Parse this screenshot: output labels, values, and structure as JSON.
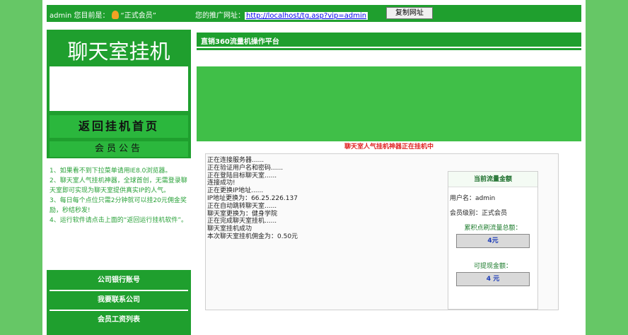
{
  "topbar": {
    "user": "admin",
    "level_prefix": "您目前是：",
    "level": "“正式会员”",
    "promo_label": "您的推广网址：",
    "promo_url": "http://localhost/tg.asp?vip=admin",
    "copy_button": "复制网址"
  },
  "sidebar": {
    "logo_title": "聊天室挂机",
    "home_link": "返回挂机首页",
    "notice_title": "会员公告",
    "notices": [
      "1、如果看不到下拉菜单请用IE8.0浏览器。",
      "2、聊天室人气挂机神器，全球首创，无需登录聊天室即可实现为聊天室提供真实IP的人气。",
      "3、每日每个点位只需2分钟就可以挂20元佣金奖励，秒结秒发!",
      "4、运行软件请点击上面的“返回运行挂机软件”。"
    ],
    "buttons": [
      "公司银行账号",
      "我要联系公司",
      "会员工资列表"
    ]
  },
  "main": {
    "header": "直销360流量机操作平台",
    "status": "聊天室人气挂机神器正在挂机中",
    "log": [
      "正在连接服务器......",
      "正在验证用户名和密码......",
      "正在登陆目标聊天室......",
      "连接成功!",
      "正在更换IP地址......",
      "IP地址更换为：66.25.226.137",
      "正在自动跳转聊天室......",
      "聊天室更换为：健身学院",
      "正在完成聊天室挂机......",
      "聊天室挂机成功",
      "本次聊天室挂机佣金为：0.50元"
    ],
    "info": {
      "header": "当前流量金额",
      "username": "用户名：admin",
      "level": "会员级别：正式会员",
      "total_label": "累积点刷流量总额：",
      "total_value": "4元",
      "withdraw_label": "可提现金额：",
      "withdraw_value": "4 元"
    }
  },
  "colors": {
    "outer_bg": "#66c766",
    "bar_green": "#1f9f2e",
    "banner_green": "#40bf48",
    "status_red": "#e02020"
  }
}
